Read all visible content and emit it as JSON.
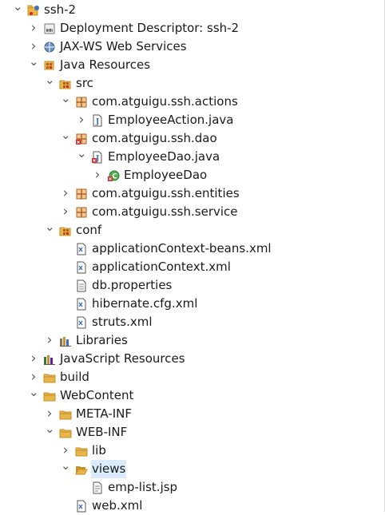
{
  "project_explorer": {
    "items": [
      {
        "label": "ssh-2",
        "icon": "project-icon",
        "level": 0,
        "expanded": true
      },
      {
        "label": "Deployment Descriptor: ssh-2",
        "icon": "deployment-descriptor-icon",
        "level": 1,
        "expanded": false
      },
      {
        "label": "JAX-WS Web Services",
        "icon": "web-services-icon",
        "level": 1,
        "expanded": false
      },
      {
        "label": "Java Resources",
        "icon": "java-resources-icon",
        "level": 1,
        "expanded": true
      },
      {
        "label": "src",
        "icon": "source-folder-icon",
        "level": 2,
        "expanded": true
      },
      {
        "label": "com.atguigu.ssh.actions",
        "icon": "package-icon",
        "level": 3,
        "expanded": true
      },
      {
        "label": "EmployeeAction.java",
        "icon": "java-file-icon",
        "level": 4,
        "expanded": false
      },
      {
        "label": "com.atguigu.ssh.dao",
        "icon": "package-error-icon",
        "level": 3,
        "expanded": true
      },
      {
        "label": "EmployeeDao.java",
        "icon": "java-file-error-icon",
        "level": 4,
        "expanded": true
      },
      {
        "label": "EmployeeDao",
        "icon": "class-icon",
        "level": 5,
        "expanded": false
      },
      {
        "label": "com.atguigu.ssh.entities",
        "icon": "package-icon",
        "level": 3,
        "expanded": false
      },
      {
        "label": "com.atguigu.ssh.service",
        "icon": "package-icon",
        "level": 3,
        "expanded": false
      },
      {
        "label": "conf",
        "icon": "source-folder-icon",
        "level": 2,
        "expanded": true
      },
      {
        "label": "applicationContext-beans.xml",
        "icon": "xml-file-icon",
        "level": 3,
        "expanded": null
      },
      {
        "label": "applicationContext.xml",
        "icon": "xml-file-icon",
        "level": 3,
        "expanded": null
      },
      {
        "label": "db.properties",
        "icon": "properties-file-icon",
        "level": 3,
        "expanded": null
      },
      {
        "label": "hibernate.cfg.xml",
        "icon": "xml-file-icon",
        "level": 3,
        "expanded": null
      },
      {
        "label": "struts.xml",
        "icon": "xml-file-icon",
        "level": 3,
        "expanded": null
      },
      {
        "label": "Libraries",
        "icon": "libraries-icon",
        "level": 2,
        "expanded": false
      },
      {
        "label": "JavaScript Resources",
        "icon": "javascript-resources-icon",
        "level": 1,
        "expanded": false
      },
      {
        "label": "build",
        "icon": "folder-icon",
        "level": 1,
        "expanded": false
      },
      {
        "label": "WebContent",
        "icon": "folder-icon",
        "level": 1,
        "expanded": true
      },
      {
        "label": "META-INF",
        "icon": "folder-icon",
        "level": 2,
        "expanded": false
      },
      {
        "label": "WEB-INF",
        "icon": "folder-icon",
        "level": 2,
        "expanded": true
      },
      {
        "label": "lib",
        "icon": "folder-icon",
        "level": 3,
        "expanded": false
      },
      {
        "label": "views",
        "icon": "folder-open-icon",
        "level": 3,
        "expanded": true,
        "selected": true
      },
      {
        "label": "emp-list.jsp",
        "icon": "jsp-file-icon",
        "level": 4,
        "expanded": null
      },
      {
        "label": "web.xml",
        "icon": "xml-file-icon",
        "level": 3,
        "expanded": null
      }
    ]
  },
  "colors": {
    "selection": "#dcebfc",
    "folder": "#e8b54a",
    "package": "#b0601e",
    "error": "#d92323",
    "class": "#3fa34d"
  }
}
